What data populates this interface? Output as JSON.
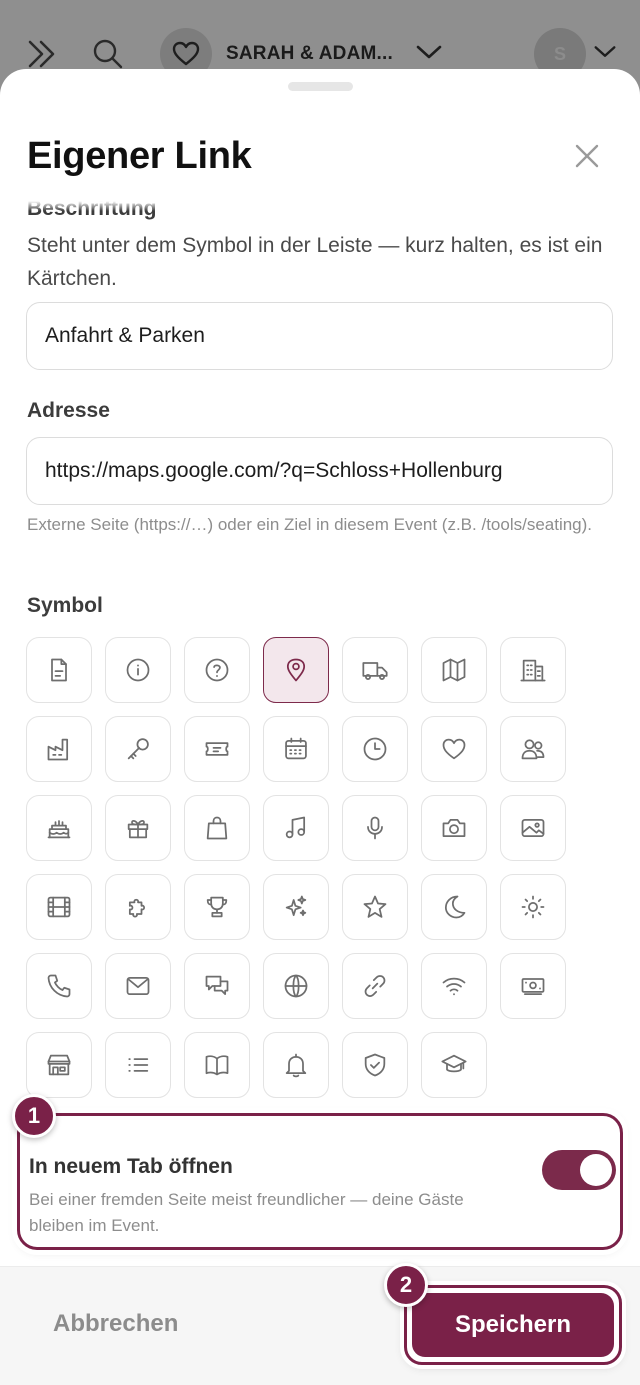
{
  "topbar": {
    "event_name": "SARAH & ADAM...",
    "avatar_initial": "S"
  },
  "sheet": {
    "title": "Eigener Link",
    "fields": {
      "caption_label": "Beschriftung",
      "caption_help": "Steht unter dem Symbol in der Leiste — kurz halten, es ist ein Kärtchen.",
      "caption_value": "Anfahrt & Parken",
      "address_label": "Adresse",
      "address_value": "https://maps.google.com/?q=Schloss+Hollenburg",
      "address_hint": "Externe Seite (https://…) oder ein Ziel in diesem Event (z.B. /tools/seating).",
      "symbol_label": "Symbol"
    },
    "icons": [
      "document-icon",
      "info-icon",
      "question-icon",
      "map-pin-icon",
      "truck-icon",
      "map-icon",
      "building-icon",
      "factory-icon",
      "key-icon",
      "ticket-icon",
      "calendar-icon",
      "clock-icon",
      "heart-icon",
      "users-icon",
      "cake-icon",
      "gift-icon",
      "shopping-bag-icon",
      "music-icon",
      "microphone-icon",
      "camera-icon",
      "image-icon",
      "film-icon",
      "puzzle-icon",
      "trophy-icon",
      "sparkles-icon",
      "star-icon",
      "moon-icon",
      "sun-icon",
      "phone-icon",
      "mail-icon",
      "chat-icon",
      "globe-icon",
      "link-icon",
      "wifi-icon",
      "money-icon",
      "store-icon",
      "list-icon",
      "book-icon",
      "bell-icon",
      "shield-icon",
      "graduation-cap-icon"
    ],
    "selected_icon": "map-pin-icon",
    "new_tab": {
      "title": "In neuem Tab öffnen",
      "description": "Bei einer fremden Seite meist freundlicher — deine Gäste bleiben im Event.",
      "enabled": true
    },
    "buttons": {
      "cancel": "Abbrechen",
      "save": "Speichern"
    }
  },
  "badges": {
    "toggle": "1",
    "save": "2"
  },
  "colors": {
    "accent": "#7a2148",
    "selected_tile_bg": "#f3e7ec",
    "overlay": "#8a8a8a"
  }
}
